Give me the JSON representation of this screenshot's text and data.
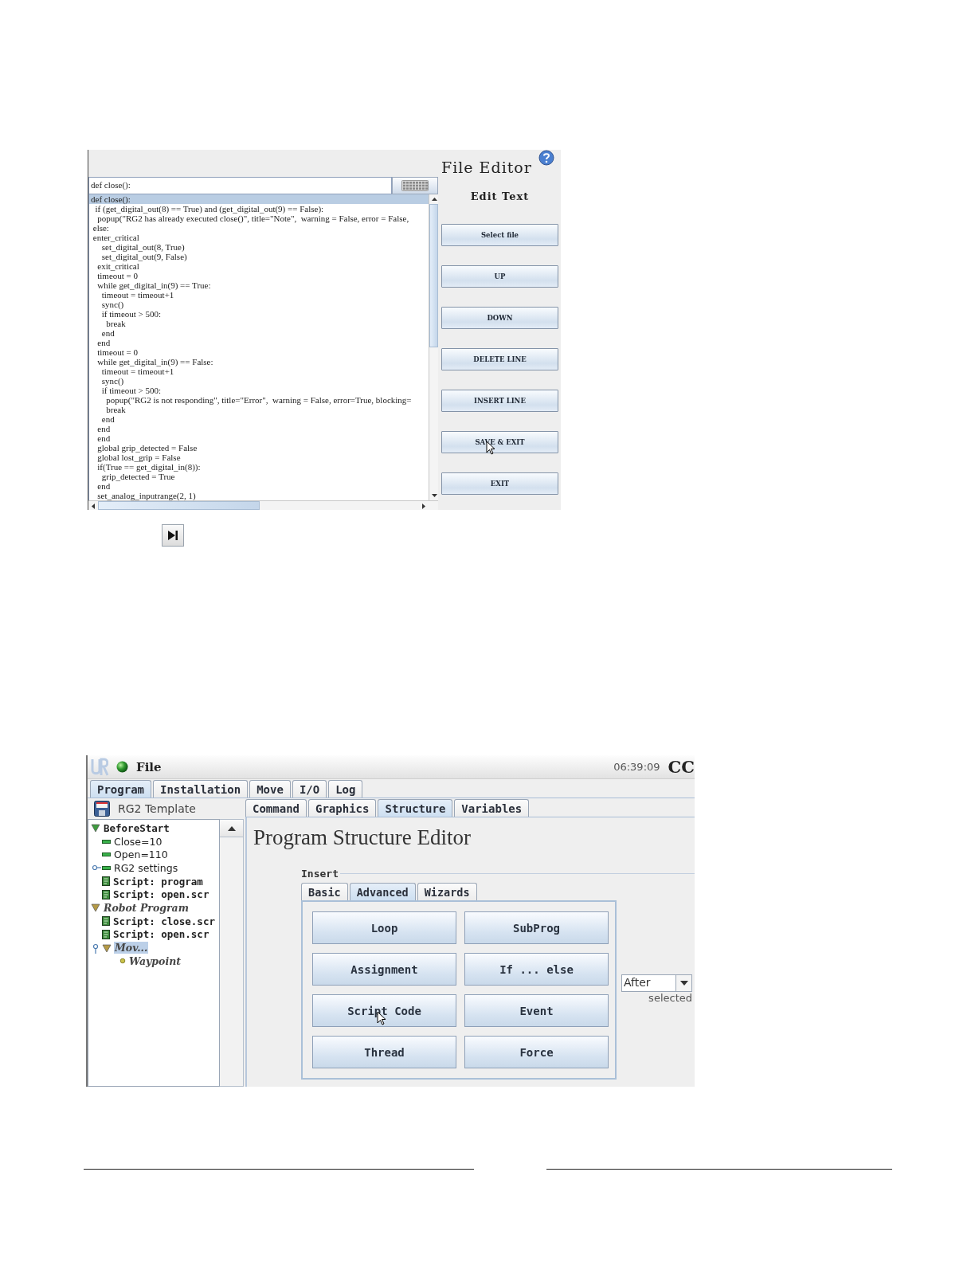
{
  "file_editor": {
    "title": "File Editor",
    "command": {
      "value": "def close():"
    },
    "code_lines": [
      {
        "text": "def close():",
        "selected": true
      },
      {
        "text": "  if (get_digital_out(8) == True) and (get_digital_out(9) == False):",
        "selected": false
      },
      {
        "text": "   popup(\"RG2 has already executed close()\", title=\"Note\",  warning = False, error = False,",
        "selected": false
      },
      {
        "text": " else:",
        "selected": false
      },
      {
        "text": " enter_critical",
        "selected": false
      },
      {
        "text": "     set_digital_out(8, True)",
        "selected": false
      },
      {
        "text": "     set_digital_out(9, False)",
        "selected": false
      },
      {
        "text": "   exit_critical",
        "selected": false
      },
      {
        "text": "   timeout = 0",
        "selected": false
      },
      {
        "text": "   while get_digital_in(9) == True:",
        "selected": false
      },
      {
        "text": "     timeout = timeout+1",
        "selected": false
      },
      {
        "text": "     sync()",
        "selected": false
      },
      {
        "text": "     if timeout > 500:",
        "selected": false
      },
      {
        "text": "       break",
        "selected": false
      },
      {
        "text": "     end",
        "selected": false
      },
      {
        "text": "   end",
        "selected": false
      },
      {
        "text": "   timeout = 0",
        "selected": false
      },
      {
        "text": "   while get_digital_in(9) == False:",
        "selected": false
      },
      {
        "text": "     timeout = timeout+1",
        "selected": false
      },
      {
        "text": "     sync()",
        "selected": false
      },
      {
        "text": "     if timeout > 500:",
        "selected": false
      },
      {
        "text": "       popup(\"RG2 is not responding\", title=\"Error\",  warning = False, error=True, blocking=",
        "selected": false
      },
      {
        "text": "       break",
        "selected": false
      },
      {
        "text": "     end",
        "selected": false
      },
      {
        "text": "   end",
        "selected": false
      },
      {
        "text": "   end",
        "selected": false
      },
      {
        "text": "   global grip_detected = False",
        "selected": false
      },
      {
        "text": "   global lost_grip = False",
        "selected": false
      },
      {
        "text": "   if(True == get_digital_in(8)):",
        "selected": false
      },
      {
        "text": "     grip_detected = True",
        "selected": false
      },
      {
        "text": "   end",
        "selected": false
      },
      {
        "text": "   set_analog_inputrange(2, 1)",
        "selected": false
      }
    ],
    "panel_title": "Edit Text",
    "buttons": [
      {
        "label": "Select file",
        "pointer": false
      },
      {
        "label": "UP",
        "pointer": false
      },
      {
        "label": "DOWN",
        "pointer": false
      },
      {
        "label": "DELETE LINE",
        "pointer": false
      },
      {
        "label": "INSERT LINE",
        "pointer": false
      },
      {
        "label": "SAVE & EXIT",
        "pointer": true
      },
      {
        "label": "EXIT",
        "pointer": false
      }
    ]
  },
  "robot": {
    "menu": "File",
    "time": "06:39:09",
    "status": "CC",
    "tabs": [
      {
        "label": "Program",
        "selected": true
      },
      {
        "label": "Installation",
        "selected": false
      },
      {
        "label": "Move",
        "selected": false
      },
      {
        "label": "I/O",
        "selected": false
      },
      {
        "label": "Log",
        "selected": false
      }
    ],
    "program_name": "RG2 Template",
    "tree": [
      {
        "label": "BeforeStart",
        "kind": "before_start",
        "italic": false,
        "selected": false,
        "expanded": true,
        "children": [
          {
            "label": "Close=10",
            "kind": "variable",
            "italic": false,
            "selected": false
          },
          {
            "label": "Open=110",
            "kind": "variable",
            "italic": false,
            "selected": false
          },
          {
            "label": "RG2 settings",
            "kind": "variable",
            "italic": false,
            "selected": false,
            "expanded": false
          },
          {
            "label": "Script: program",
            "kind": "script",
            "italic": false,
            "selected": false
          },
          {
            "label": "Script: open.scr",
            "kind": "script",
            "italic": false,
            "selected": false
          }
        ]
      },
      {
        "label": "Robot Program",
        "kind": "program",
        "italic": true,
        "selected": false,
        "expanded": true,
        "children": [
          {
            "label": "Script: close.scr",
            "kind": "script",
            "italic": false,
            "selected": false
          },
          {
            "label": "Script: open.scr",
            "kind": "script",
            "italic": false,
            "selected": false
          },
          {
            "label": "Mov...",
            "kind": "move",
            "italic": true,
            "selected": true,
            "expanded": true,
            "children": [
              {
                "label": "Waypoint",
                "kind": "waypoint",
                "italic": true,
                "selected": false
              }
            ]
          }
        ]
      }
    ],
    "sub_tabs": [
      {
        "label": "Command",
        "selected": false
      },
      {
        "label": "Graphics",
        "selected": false
      },
      {
        "label": "Structure",
        "selected": true
      },
      {
        "label": "Variables",
        "selected": false
      }
    ],
    "title": "Program Structure Editor",
    "insert": {
      "label": "Insert",
      "tabs": [
        {
          "label": "Basic",
          "selected": false
        },
        {
          "label": "Advanced",
          "selected": true
        },
        {
          "label": "Wizards",
          "selected": false
        }
      ],
      "buttons": [
        {
          "label": "Loop",
          "pointer": false
        },
        {
          "label": "SubProg",
          "pointer": false
        },
        {
          "label": "Assignment",
          "pointer": false
        },
        {
          "label": "If ... else",
          "pointer": false
        },
        {
          "label": "Script Code",
          "pointer": true
        },
        {
          "label": "Event",
          "pointer": false
        },
        {
          "label": "Thread",
          "pointer": false
        },
        {
          "label": "Force",
          "pointer": false
        }
      ],
      "position": {
        "value": "After",
        "caption": "selected"
      }
    }
  }
}
